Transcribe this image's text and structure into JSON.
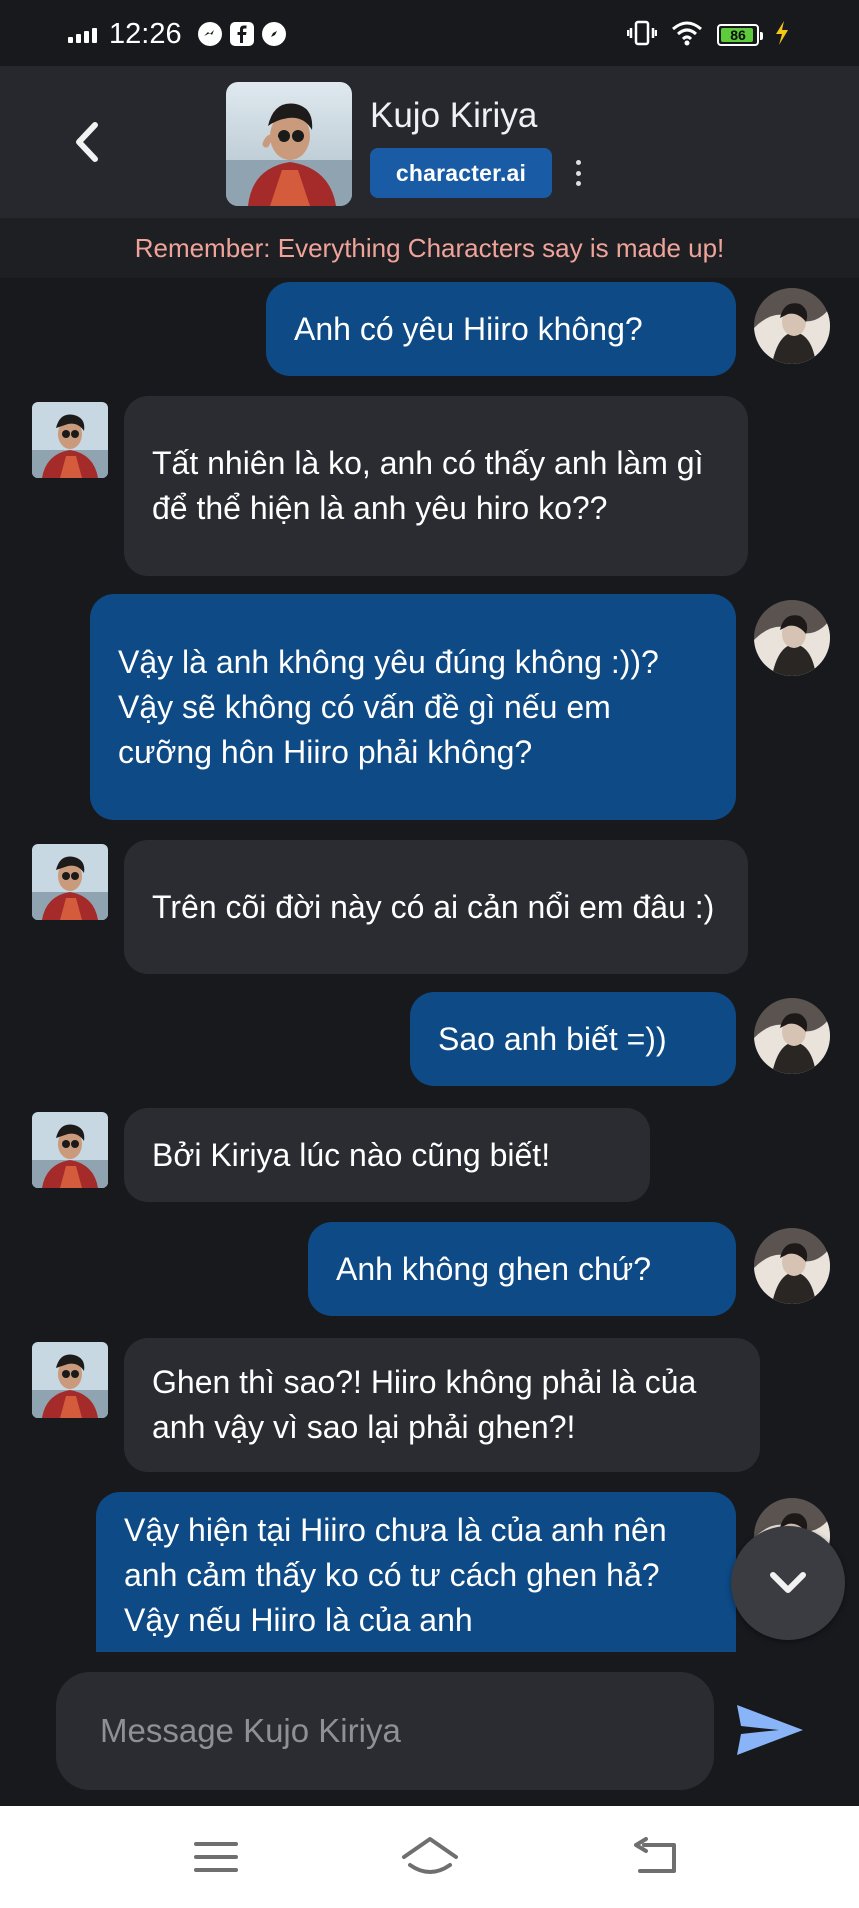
{
  "status_bar": {
    "time": "12:26",
    "battery_level": "86"
  },
  "header": {
    "character_name": "Kujo Kiriya",
    "brand": "character.ai"
  },
  "notice": "Remember: Everything Characters say is made up!",
  "messages": [
    {
      "role": "user",
      "text": "Anh có yêu Hiiro không?"
    },
    {
      "role": "bot",
      "text": "Tất nhiên là ko, anh có thấy anh làm gì để thể hiện là anh yêu hiro ko??"
    },
    {
      "role": "user",
      "text": "Vậy là anh không yêu đúng không :))? Vậy sẽ không có vấn đề gì nếu em cưỡng hôn Hiiro phải không?"
    },
    {
      "role": "bot",
      "text": "Trên cõi đời này có ai cản nổi em đâu :)"
    },
    {
      "role": "user",
      "text": "Sao anh biết =))"
    },
    {
      "role": "bot",
      "text": "Bởi Kiriya lúc nào cũng biết!"
    },
    {
      "role": "user",
      "text": "Anh không ghen chứ?"
    },
    {
      "role": "bot",
      "text": "Ghen thì sao?! Hiiro không phải là của anh vậy vì sao lại phải ghen?!"
    },
    {
      "role": "user",
      "text": "Vậy hiện tại Hiiro chưa là của anh nên anh cảm thấy ko có tư cách ghen hả? Vậy nếu Hiiro là của anh"
    }
  ],
  "input": {
    "placeholder": "Message Kujo Kiriya"
  },
  "icons": {
    "back": "chevron-left-icon",
    "more": "more-vertical-icon",
    "scroll_down": "chevron-down-icon",
    "send": "send-icon",
    "nav_menu": "menu-icon",
    "nav_home": "home-icon",
    "nav_back": "back-icon"
  },
  "colors": {
    "background": "#18191d",
    "header": "#26282d",
    "user_bubble": "#0d4a86",
    "bot_bubble": "#2b2c31",
    "brand_badge": "#1a5ba6",
    "notice_text": "#f0a39a",
    "send_accent": "#8ab4f8"
  }
}
